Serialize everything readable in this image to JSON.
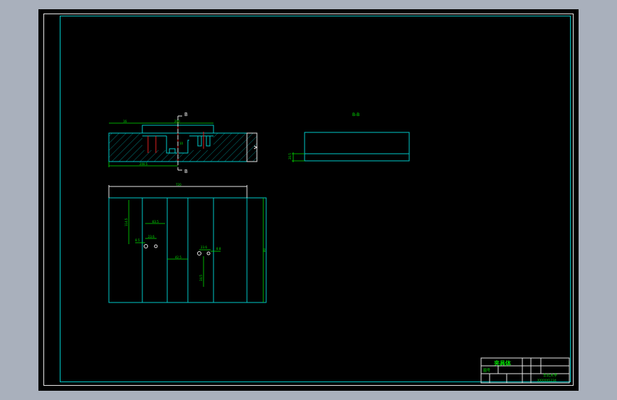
{
  "section_labels": {
    "cut_top": "B",
    "cut_bottom": "B",
    "section_title": "B-B"
  },
  "dimensions": {
    "front_left": "16",
    "front_top": "200",
    "front_bottom": "208.5",
    "front_v1": "10",
    "section_height": "20.5",
    "plan_width": "720",
    "plan_left_v": "114.5",
    "plan_h1": "83.5",
    "plan_h2": "23.6",
    "plan_small": "8.5",
    "plan_h3": "23.6",
    "plan_h4": "8.8",
    "plan_mid": "42.5",
    "plan_v2": "34.5",
    "plan_right": "80"
  },
  "title_block": {
    "part_name": "夹具体",
    "drawing_no": "图号",
    "school": "华北大学",
    "class_code": "XXXXX1234"
  }
}
